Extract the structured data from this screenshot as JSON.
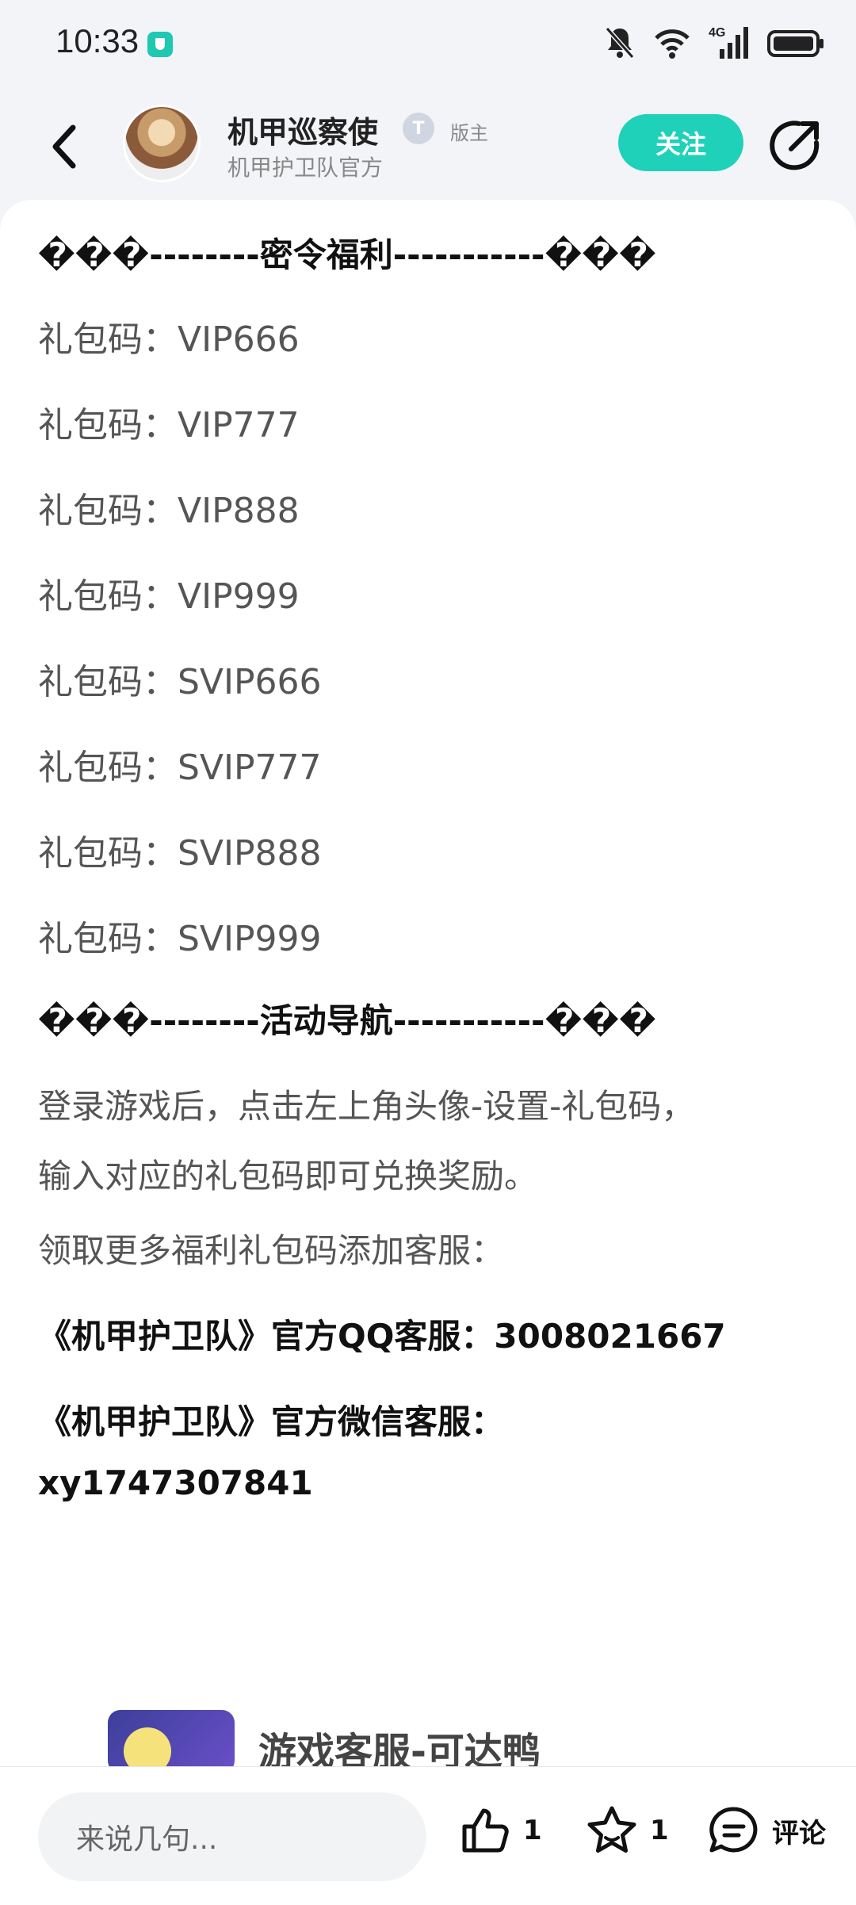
{
  "status_bar": {
    "time": "10:33",
    "icons": [
      "vpn-shield-icon",
      "bell-muted-icon",
      "wifi-icon",
      "4g-signal-icon",
      "battery-icon"
    ],
    "network_label": "4G"
  },
  "header": {
    "author_name": "机甲巡察使",
    "badge_letter": "T",
    "role_tag": "版主",
    "author_subtitle": "机甲护卫队官方",
    "follow_label": "关注",
    "accent_color": "#1fd1b9"
  },
  "post": {
    "heading_welfare": "���--------密令福利-----------���",
    "gift_codes": [
      "礼包码：VIP666",
      "礼包码：VIP777",
      "礼包码：VIP888",
      "礼包码：VIP999",
      "礼包码：SVIP666",
      "礼包码：SVIP777",
      "礼包码：SVIP888",
      "礼包码：SVIP999"
    ],
    "heading_nav": "���--------活动导航-----------���",
    "instructions_line1": "登录游戏后，点击左上角头像-设置-礼包码，",
    "instructions_line2": "输入对应的礼包码即可兑换奖励。",
    "more_line": "领取更多福利礼包码添加客服：",
    "qq_service": "《机甲护卫队》官方QQ客服：3008021667",
    "wechat_service_label": "《机甲护卫队》官方微信客服：",
    "wechat_id": "xy1747307841"
  },
  "card": {
    "title": "游戏客服-可达鸭"
  },
  "bottom_bar": {
    "comment_placeholder": "来说几句...",
    "like_count": "1",
    "favorite_count": "1",
    "comment_label": "评论"
  }
}
